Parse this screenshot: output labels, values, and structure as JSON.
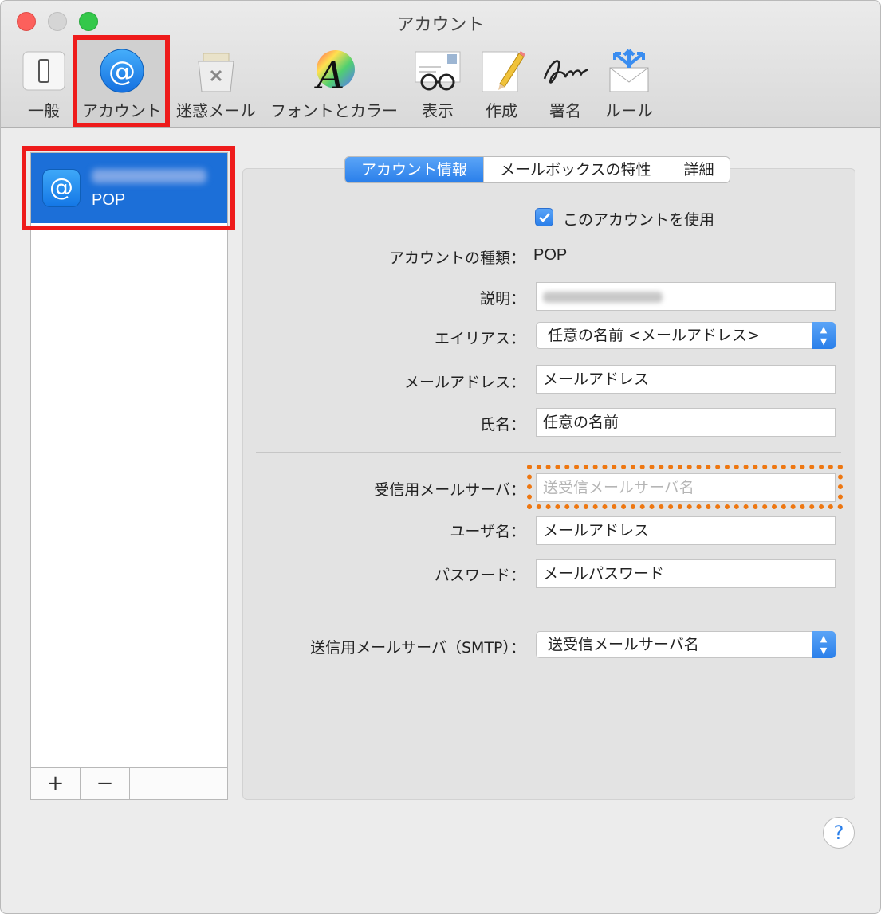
{
  "window": {
    "title": "アカウント"
  },
  "toolbar": {
    "items": [
      {
        "label": "一般",
        "icon": "switch-icon"
      },
      {
        "label": "アカウント",
        "icon": "at-sign-icon"
      },
      {
        "label": "迷惑メール",
        "icon": "trash-icon"
      },
      {
        "label": "フォントとカラー",
        "icon": "font-color-icon"
      },
      {
        "label": "表示",
        "icon": "glasses-icon"
      },
      {
        "label": "作成",
        "icon": "pencil-icon"
      },
      {
        "label": "署名",
        "icon": "signature-icon"
      },
      {
        "label": "ルール",
        "icon": "rules-envelope-icon"
      }
    ],
    "selected": "アカウント"
  },
  "sidebar": {
    "accounts": [
      {
        "type": "POP",
        "icon": "at-sign-icon"
      }
    ],
    "add_label": "+",
    "remove_label": "−"
  },
  "tabs": [
    {
      "label": "アカウント情報",
      "active": true
    },
    {
      "label": "メールボックスの特性",
      "active": false
    },
    {
      "label": "詳細",
      "active": false
    }
  ],
  "form": {
    "enable_account": {
      "label": "このアカウントを使用",
      "checked": true
    },
    "account_type": {
      "label": "アカウントの種類：",
      "value": "POP"
    },
    "description": {
      "label": "説明："
    },
    "alias": {
      "label": "エイリアス：",
      "value": "任意の名前 <メールアドレス>"
    },
    "email": {
      "label": "メールアドレス：",
      "value": "メールアドレス"
    },
    "full_name": {
      "label": "氏名：",
      "value": "任意の名前"
    },
    "incoming_server": {
      "label": "受信用メールサーバ：",
      "placeholder": "送受信メールサーバ名"
    },
    "username": {
      "label": "ユーザ名：",
      "value": "メールアドレス"
    },
    "password": {
      "label": "パスワード：",
      "value": "メールパスワード"
    },
    "outgoing_server": {
      "label": "送信用メールサーバ（SMTP）：",
      "value": "送受信メールサーバ名"
    }
  },
  "help_label": "?",
  "colors": {
    "accent": "#2a7fea",
    "highlight_red": "#ee1b1b",
    "highlight_orange": "#ee7711"
  }
}
